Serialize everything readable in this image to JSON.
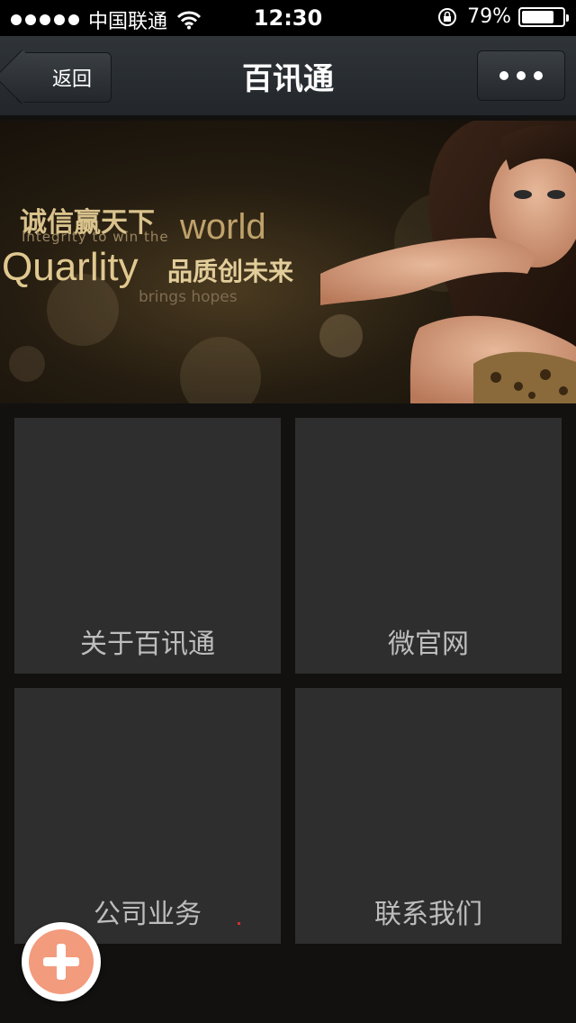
{
  "status_bar": {
    "carrier": "中国联通",
    "time": "12:30",
    "battery_percent": "79%",
    "battery_level": 0.79
  },
  "nav": {
    "back_label": "返回",
    "title": "百讯通",
    "more_icon": "more-dots-icon"
  },
  "banner": {
    "line1": "诚信赢天下",
    "line1_en": "world",
    "line2": "Integrity to win the",
    "line3": "Quarlity",
    "line3_cn": "品质创未来",
    "line4": "brings hopes"
  },
  "tiles": [
    {
      "label": "关于百讯通"
    },
    {
      "label": "微官网"
    },
    {
      "label": "公司业务"
    },
    {
      "label": "联系我们"
    }
  ],
  "fab": {
    "icon": "plus-icon"
  },
  "colors": {
    "accent": "#f39b7d",
    "tile_bg": "#2e2e2e",
    "page_bg": "#121110"
  }
}
